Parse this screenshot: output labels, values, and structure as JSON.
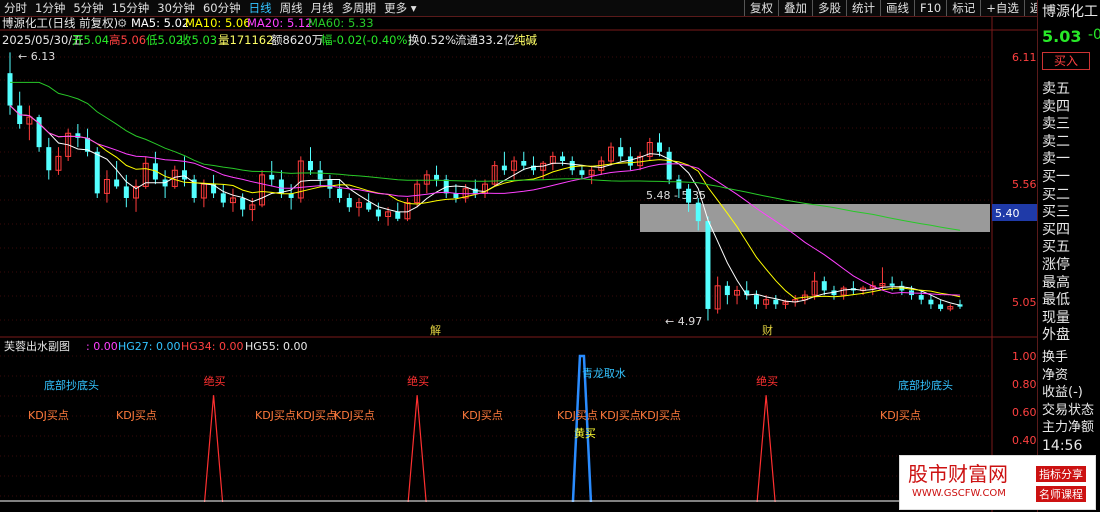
{
  "toolbar": {
    "periods": [
      "分时",
      "1分钟",
      "5分钟",
      "15分钟",
      "30分钟",
      "60分钟",
      "日线",
      "周线",
      "月线",
      "多周期",
      "更多"
    ],
    "active": "日线",
    "right_tools": [
      "复权",
      "叠加",
      "多股",
      "统计",
      "画线",
      "F10",
      "标记",
      "+自选",
      "返回"
    ]
  },
  "main_header": {
    "stock": "博源化工(日线 前复权)",
    "ma5": "MA5: 5.02",
    "ma10": "MA10: 5.06",
    "ma20": "MA20: 5.12",
    "ma60": "MA60: 5.33",
    "date": "2025/05/30/五",
    "open": "开5.04",
    "high": "高5.06",
    "low": "低5.02",
    "close": "收5.03",
    "volume": "量171162",
    "amount": "额8620万",
    "change": "幅-0.02(-0.40%)",
    "turnover": "换0.52%",
    "float_cap": "流通33.2亿",
    "tag": "纯碱"
  },
  "price_axis": [
    "6.11",
    "5.56",
    "5.05"
  ],
  "price_marker": "5.40",
  "annotations": {
    "high": "6.13",
    "low": "4.97",
    "range": "5.48 - 5.35",
    "jie": "解",
    "cai": "财"
  },
  "sub_header": {
    "name": "芙蓉出水副图",
    "v0": ": 0.00",
    "hg27": "HG27: 0.00",
    "hg34": "HG34: 0.00",
    "hg55": "HG55: 0.00"
  },
  "sub_axis": [
    "1.00",
    "0.80",
    "0.60",
    "0.40",
    "0.20"
  ],
  "signals": {
    "juemai": "绝买",
    "qinglong": "青龙取水",
    "huangmai": "黄买",
    "kdj": "KDJ买点",
    "bottom": "底部抄底头"
  },
  "right_panel": {
    "stock_name": "博源化工",
    "price": "5.03",
    "change": "-0",
    "buy_button": "买入",
    "sell_levels": [
      "卖五",
      "卖四",
      "卖三",
      "卖二",
      "卖一"
    ],
    "buy_levels": [
      "买一",
      "买二",
      "买三",
      "买四",
      "买五"
    ],
    "stats": [
      "涨停",
      "最高",
      "最低",
      "现量",
      "外盘"
    ],
    "misc": [
      "换手",
      "净资",
      "收益(-)",
      "交易状态",
      "主力净额"
    ],
    "time": "14:56"
  },
  "watermark": {
    "title": "股市财富网",
    "url": "WWW.GSCFW.COM",
    "tag1": "指标分享",
    "tag2": "名师课程"
  },
  "colors": {
    "up": "#ff3c3c",
    "down": "#54ffff",
    "ma5": "#ffffff",
    "ma10": "#ffff00",
    "ma20": "#ff40ff",
    "ma60": "#28c828",
    "grid": "#7a1a1a",
    "kdj": "#ff7a3c"
  },
  "chart_data": {
    "type": "candlestick",
    "candles": [
      {
        "o": 6.04,
        "h": 6.13,
        "l": 5.86,
        "c": 5.9
      },
      {
        "o": 5.9,
        "h": 5.96,
        "l": 5.8,
        "c": 5.82
      },
      {
        "o": 5.82,
        "h": 5.9,
        "l": 5.75,
        "c": 5.85
      },
      {
        "o": 5.85,
        "h": 5.86,
        "l": 5.7,
        "c": 5.72
      },
      {
        "o": 5.72,
        "h": 5.76,
        "l": 5.58,
        "c": 5.62
      },
      {
        "o": 5.62,
        "h": 5.72,
        "l": 5.6,
        "c": 5.68
      },
      {
        "o": 5.68,
        "h": 5.8,
        "l": 5.66,
        "c": 5.78
      },
      {
        "o": 5.78,
        "h": 5.82,
        "l": 5.72,
        "c": 5.76
      },
      {
        "o": 5.76,
        "h": 5.8,
        "l": 5.68,
        "c": 5.7
      },
      {
        "o": 5.7,
        "h": 5.72,
        "l": 5.5,
        "c": 5.52
      },
      {
        "o": 5.52,
        "h": 5.62,
        "l": 5.48,
        "c": 5.58
      },
      {
        "o": 5.58,
        "h": 5.66,
        "l": 5.54,
        "c": 5.55
      },
      {
        "o": 5.55,
        "h": 5.6,
        "l": 5.46,
        "c": 5.5
      },
      {
        "o": 5.5,
        "h": 5.58,
        "l": 5.44,
        "c": 5.55
      },
      {
        "o": 5.55,
        "h": 5.68,
        "l": 5.54,
        "c": 5.65
      },
      {
        "o": 5.65,
        "h": 5.7,
        "l": 5.56,
        "c": 5.58
      },
      {
        "o": 5.58,
        "h": 5.62,
        "l": 5.5,
        "c": 5.55
      },
      {
        "o": 5.55,
        "h": 5.64,
        "l": 5.54,
        "c": 5.62
      },
      {
        "o": 5.62,
        "h": 5.68,
        "l": 5.55,
        "c": 5.58
      },
      {
        "o": 5.58,
        "h": 5.6,
        "l": 5.48,
        "c": 5.5
      },
      {
        "o": 5.5,
        "h": 5.58,
        "l": 5.46,
        "c": 5.56
      },
      {
        "o": 5.56,
        "h": 5.6,
        "l": 5.5,
        "c": 5.52
      },
      {
        "o": 5.52,
        "h": 5.56,
        "l": 5.46,
        "c": 5.48
      },
      {
        "o": 5.48,
        "h": 5.54,
        "l": 5.44,
        "c": 5.5
      },
      {
        "o": 5.5,
        "h": 5.52,
        "l": 5.42,
        "c": 5.45
      },
      {
        "o": 5.45,
        "h": 5.5,
        "l": 5.4,
        "c": 5.47
      },
      {
        "o": 5.47,
        "h": 5.62,
        "l": 5.46,
        "c": 5.6
      },
      {
        "o": 5.6,
        "h": 5.66,
        "l": 5.55,
        "c": 5.58
      },
      {
        "o": 5.58,
        "h": 5.62,
        "l": 5.5,
        "c": 5.52
      },
      {
        "o": 5.52,
        "h": 5.56,
        "l": 5.45,
        "c": 5.5
      },
      {
        "o": 5.5,
        "h": 5.68,
        "l": 5.48,
        "c": 5.66
      },
      {
        "o": 5.66,
        "h": 5.72,
        "l": 5.6,
        "c": 5.62
      },
      {
        "o": 5.62,
        "h": 5.66,
        "l": 5.55,
        "c": 5.58
      },
      {
        "o": 5.58,
        "h": 5.6,
        "l": 5.5,
        "c": 5.54
      },
      {
        "o": 5.54,
        "h": 5.58,
        "l": 5.48,
        "c": 5.5
      },
      {
        "o": 5.5,
        "h": 5.52,
        "l": 5.44,
        "c": 5.46
      },
      {
        "o": 5.46,
        "h": 5.5,
        "l": 5.42,
        "c": 5.48
      },
      {
        "o": 5.48,
        "h": 5.52,
        "l": 5.44,
        "c": 5.45
      },
      {
        "o": 5.45,
        "h": 5.48,
        "l": 5.4,
        "c": 5.42
      },
      {
        "o": 5.42,
        "h": 5.46,
        "l": 5.38,
        "c": 5.44
      },
      {
        "o": 5.44,
        "h": 5.48,
        "l": 5.4,
        "c": 5.41
      },
      {
        "o": 5.41,
        "h": 5.5,
        "l": 5.4,
        "c": 5.48
      },
      {
        "o": 5.48,
        "h": 5.58,
        "l": 5.46,
        "c": 5.56
      },
      {
        "o": 5.56,
        "h": 5.62,
        "l": 5.52,
        "c": 5.6
      },
      {
        "o": 5.6,
        "h": 5.64,
        "l": 5.55,
        "c": 5.58
      },
      {
        "o": 5.58,
        "h": 5.6,
        "l": 5.5,
        "c": 5.52
      },
      {
        "o": 5.52,
        "h": 5.56,
        "l": 5.48,
        "c": 5.5
      },
      {
        "o": 5.5,
        "h": 5.56,
        "l": 5.48,
        "c": 5.54
      },
      {
        "o": 5.54,
        "h": 5.58,
        "l": 5.5,
        "c": 5.52
      },
      {
        "o": 5.52,
        "h": 5.58,
        "l": 5.5,
        "c": 5.56
      },
      {
        "o": 5.56,
        "h": 5.66,
        "l": 5.55,
        "c": 5.64
      },
      {
        "o": 5.64,
        "h": 5.7,
        "l": 5.6,
        "c": 5.62
      },
      {
        "o": 5.62,
        "h": 5.68,
        "l": 5.58,
        "c": 5.66
      },
      {
        "o": 5.66,
        "h": 5.7,
        "l": 5.62,
        "c": 5.64
      },
      {
        "o": 5.64,
        "h": 5.68,
        "l": 5.6,
        "c": 5.62
      },
      {
        "o": 5.62,
        "h": 5.66,
        "l": 5.58,
        "c": 5.65
      },
      {
        "o": 5.65,
        "h": 5.7,
        "l": 5.62,
        "c": 5.68
      },
      {
        "o": 5.68,
        "h": 5.7,
        "l": 5.64,
        "c": 5.66
      },
      {
        "o": 5.66,
        "h": 5.68,
        "l": 5.6,
        "c": 5.62
      },
      {
        "o": 5.62,
        "h": 5.64,
        "l": 5.58,
        "c": 5.6
      },
      {
        "o": 5.6,
        "h": 5.64,
        "l": 5.56,
        "c": 5.62
      },
      {
        "o": 5.62,
        "h": 5.68,
        "l": 5.6,
        "c": 5.66
      },
      {
        "o": 5.66,
        "h": 5.74,
        "l": 5.64,
        "c": 5.72
      },
      {
        "o": 5.72,
        "h": 5.76,
        "l": 5.66,
        "c": 5.68
      },
      {
        "o": 5.68,
        "h": 5.72,
        "l": 5.62,
        "c": 5.64
      },
      {
        "o": 5.64,
        "h": 5.7,
        "l": 5.62,
        "c": 5.68
      },
      {
        "o": 5.68,
        "h": 5.76,
        "l": 5.66,
        "c": 5.74
      },
      {
        "o": 5.74,
        "h": 5.78,
        "l": 5.68,
        "c": 5.7
      },
      {
        "o": 5.7,
        "h": 5.72,
        "l": 5.56,
        "c": 5.58
      },
      {
        "o": 5.58,
        "h": 5.6,
        "l": 5.5,
        "c": 5.54
      },
      {
        "o": 5.54,
        "h": 5.56,
        "l": 5.44,
        "c": 5.48
      },
      {
        "o": 5.48,
        "h": 5.5,
        "l": 5.36,
        "c": 5.4
      },
      {
        "o": 5.4,
        "h": 5.42,
        "l": 4.97,
        "c": 5.02
      },
      {
        "o": 5.02,
        "h": 5.16,
        "l": 5.0,
        "c": 5.12
      },
      {
        "o": 5.12,
        "h": 5.14,
        "l": 5.04,
        "c": 5.08
      },
      {
        "o": 5.08,
        "h": 5.12,
        "l": 5.04,
        "c": 5.1
      },
      {
        "o": 5.1,
        "h": 5.14,
        "l": 5.06,
        "c": 5.08
      },
      {
        "o": 5.08,
        "h": 5.1,
        "l": 5.02,
        "c": 5.04
      },
      {
        "o": 5.04,
        "h": 5.08,
        "l": 5.02,
        "c": 5.06
      },
      {
        "o": 5.06,
        "h": 5.08,
        "l": 5.02,
        "c": 5.04
      },
      {
        "o": 5.04,
        "h": 5.06,
        "l": 5.02,
        "c": 5.05
      },
      {
        "o": 5.05,
        "h": 5.08,
        "l": 5.03,
        "c": 5.06
      },
      {
        "o": 5.06,
        "h": 5.1,
        "l": 5.04,
        "c": 5.08
      },
      {
        "o": 5.08,
        "h": 5.18,
        "l": 5.06,
        "c": 5.14
      },
      {
        "o": 5.14,
        "h": 5.16,
        "l": 5.08,
        "c": 5.1
      },
      {
        "o": 5.1,
        "h": 5.12,
        "l": 5.06,
        "c": 5.08
      },
      {
        "o": 5.08,
        "h": 5.12,
        "l": 5.06,
        "c": 5.11
      },
      {
        "o": 5.11,
        "h": 5.14,
        "l": 5.08,
        "c": 5.1
      },
      {
        "o": 5.1,
        "h": 5.12,
        "l": 5.08,
        "c": 5.11
      },
      {
        "o": 5.11,
        "h": 5.14,
        "l": 5.08,
        "c": 5.12
      },
      {
        "o": 5.12,
        "h": 5.2,
        "l": 5.1,
        "c": 5.13
      },
      {
        "o": 5.13,
        "h": 5.16,
        "l": 5.1,
        "c": 5.12
      },
      {
        "o": 5.12,
        "h": 5.14,
        "l": 5.08,
        "c": 5.1
      },
      {
        "o": 5.1,
        "h": 5.12,
        "l": 5.06,
        "c": 5.08
      },
      {
        "o": 5.08,
        "h": 5.1,
        "l": 5.04,
        "c": 5.06
      },
      {
        "o": 5.06,
        "h": 5.08,
        "l": 5.02,
        "c": 5.04
      },
      {
        "o": 5.04,
        "h": 5.06,
        "l": 5.01,
        "c": 5.02
      },
      {
        "o": 5.02,
        "h": 5.04,
        "l": 5.01,
        "c": 5.03
      },
      {
        "o": 5.04,
        "h": 5.06,
        "l": 5.02,
        "c": 5.03
      }
    ],
    "signal_peaks": {
      "juemai": [
        21,
        42,
        78
      ],
      "qinglong": [
        59
      ]
    }
  }
}
